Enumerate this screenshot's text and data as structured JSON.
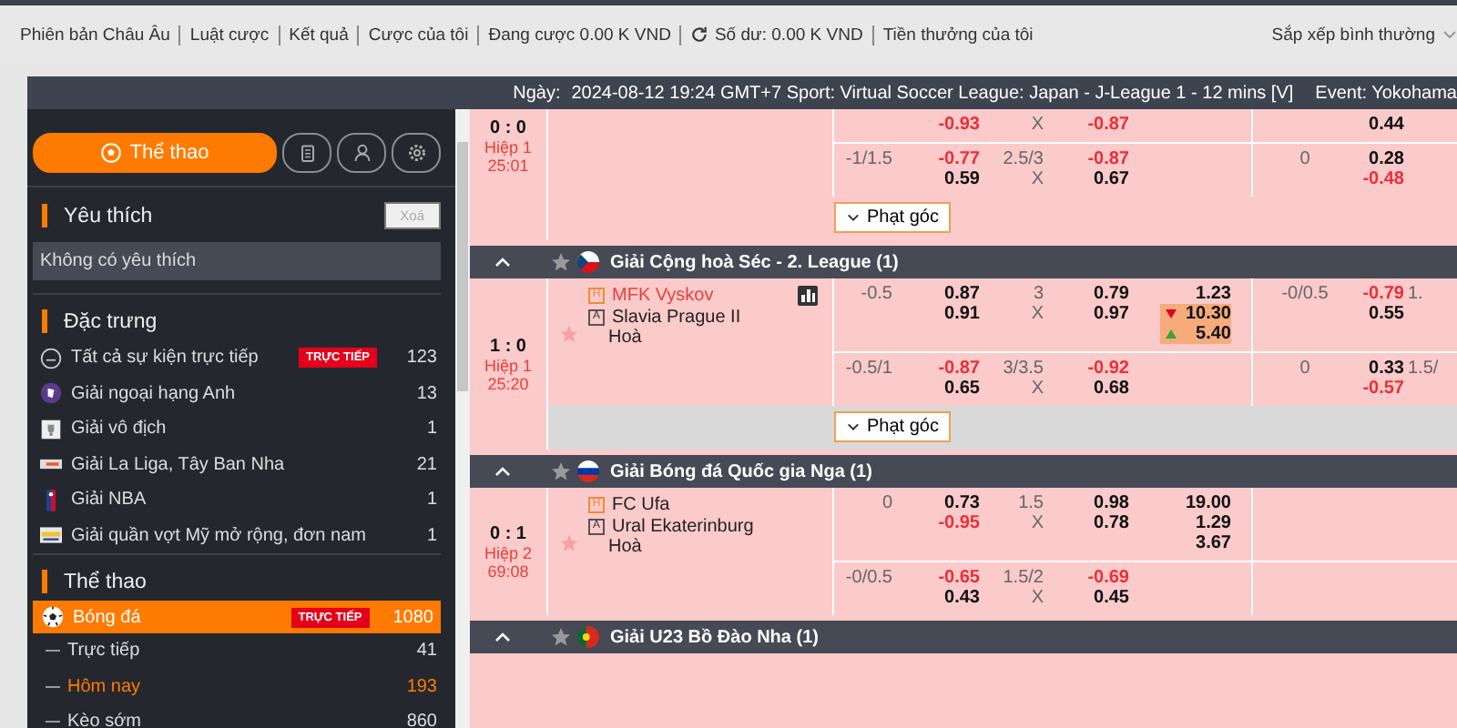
{
  "nav": {
    "items": [
      {
        "label": "Phiên bản Châu Âu",
        "refresh": false
      },
      {
        "label": "Luật cược",
        "refresh": false
      },
      {
        "label": "Kết quả",
        "refresh": false
      },
      {
        "label": "Cược của tôi",
        "refresh": false
      },
      {
        "label": "Đang cược 0.00 K VND",
        "refresh": false
      },
      {
        "label": "Số dư: 0.00 K VND",
        "refresh": true
      },
      {
        "label": "Tiền thưởng của tôi",
        "refresh": false
      }
    ],
    "sort": "Sắp xếp bình thường"
  },
  "info_bar": {
    "date_label": "Ngày:",
    "details": "2024-08-12 19:24 GMT+7 Sport: Virtual Soccer League: Japan - J-League 1 - 12 mins [V]",
    "event": "Event: Yokohama"
  },
  "sidebar": {
    "tabs": [
      {
        "kind": "sports",
        "label": "Thể thao",
        "selected": true
      },
      {
        "kind": "slip",
        "selected": false
      },
      {
        "kind": "account",
        "selected": false
      },
      {
        "kind": "settings",
        "selected": false
      }
    ],
    "favorites": {
      "title": "Yêu thích",
      "clear": "Xoá",
      "empty": "Không có yêu thích"
    },
    "featured": {
      "title": "Đặc trưng",
      "items": [
        {
          "kind": "all",
          "label": "Tất cả sự kiện trực tiếp",
          "badge": "TRỰC TIẾP",
          "count": "123"
        },
        {
          "kind": "league",
          "label": "Giải ngoại hạng Anh",
          "count": "13"
        },
        {
          "kind": "trophy",
          "label": "Giải vô địch",
          "count": "1"
        },
        {
          "kind": "banner",
          "label": "Giải La Liga, Tây Ban Nha",
          "count": "21"
        },
        {
          "kind": "basketball",
          "label": "Giải NBA",
          "count": "1"
        },
        {
          "kind": "tennis",
          "label": "Giải quần vợt Mỹ mở rộng, đơn nam",
          "count": "1"
        }
      ]
    },
    "sports": {
      "title": "Thể thao",
      "items": [
        {
          "label": "Bóng đá",
          "badge": "TRỰC TIẾP",
          "count": "1080",
          "selected": true,
          "children": [
            {
              "label": "Trực tiếp",
              "count": "41",
              "selected": false
            },
            {
              "label": "Hôm nay",
              "count": "193",
              "selected": true
            },
            {
              "label": "Kèo sớm",
              "count": "860",
              "selected": false
            }
          ]
        }
      ]
    }
  },
  "sections": [
    {
      "matches": [
        {
          "score": "0 : 0",
          "period": "Hiệp 1",
          "clock": "25:01",
          "lines": [
            {
              "handicap_odds": [
                {
                  "text": "-0.93",
                  "kind": "neg"
                }
              ],
              "total": [
                {
                  "text": "X",
                  "kind": "line"
                }
              ],
              "total_odds": [
                {
                  "text": "-0.87",
                  "kind": "neg"
                }
              ],
              "half_odds": [
                {
                  "text": "0.44",
                  "kind": "odd"
                }
              ]
            },
            {
              "handicap": [
                {
                  "text": "-1/1.5",
                  "kind": "line"
                }
              ],
              "handicap_odds": [
                {
                  "text": "-0.77",
                  "kind": "neg"
                },
                {
                  "text": "0.59",
                  "kind": "odd"
                }
              ],
              "total": [
                {
                  "text": "2.5/3",
                  "kind": "line"
                },
                {
                  "text": "X",
                  "kind": "line"
                }
              ],
              "total_odds": [
                {
                  "text": "-0.87",
                  "kind": "neg"
                },
                {
                  "text": "0.67",
                  "kind": "odd"
                }
              ],
              "half_handicap": [
                {
                  "text": "0",
                  "kind": "line"
                }
              ],
              "half_odds": [
                {
                  "text": "0.28",
                  "kind": "odd"
                },
                {
                  "text": "-0.48",
                  "kind": "neg"
                }
              ]
            }
          ],
          "corner": {
            "label": "Phạt góc",
            "shaded": false
          }
        }
      ]
    },
    {
      "league": "Giải Cộng hoà Séc - 2. League (1)",
      "flag": {
        "kind": "cz"
      },
      "matches": [
        {
          "score": "1 : 0",
          "period": "Hiệp 1",
          "clock": "25:20",
          "stats": true,
          "teams": [
            {
              "badge": "H",
              "name": "MFK Vyskov",
              "highlight": true
            },
            {
              "badge": "A",
              "name": "Slavia Prague II",
              "highlight": false
            }
          ],
          "draw": "Hoà",
          "lines": [
            {
              "handicap": [
                {
                  "text": "-0.5",
                  "kind": "line"
                }
              ],
              "handicap_odds": [
                {
                  "text": "0.87",
                  "kind": "odd"
                },
                {
                  "text": "0.91",
                  "kind": "odd"
                }
              ],
              "total": [
                {
                  "text": "3",
                  "kind": "line"
                },
                {
                  "text": "X",
                  "kind": "line"
                }
              ],
              "total_odds": [
                {
                  "text": "0.79",
                  "kind": "odd"
                },
                {
                  "text": "0.97",
                  "kind": "odd"
                }
              ],
              "result": [
                {
                  "text": "1.23",
                  "kind": "odd"
                },
                {
                  "text": "10.30",
                  "kind": "falling"
                },
                {
                  "text": "5.40",
                  "kind": "rising"
                }
              ],
              "half_handicap": [
                {
                  "text": "-0/0.5",
                  "kind": "line"
                }
              ],
              "half_odds": [
                {
                  "text": "-0.79",
                  "kind": "neg"
                },
                {
                  "text": "0.55",
                  "kind": "odd"
                }
              ],
              "half_total": [
                {
                  "text": "1.",
                  "kind": "line"
                }
              ]
            },
            {
              "handicap": [
                {
                  "text": "-0.5/1",
                  "kind": "line"
                }
              ],
              "handicap_odds": [
                {
                  "text": "-0.87",
                  "kind": "neg"
                },
                {
                  "text": "0.65",
                  "kind": "odd"
                }
              ],
              "total": [
                {
                  "text": "3/3.5",
                  "kind": "line"
                },
                {
                  "text": "X",
                  "kind": "line"
                }
              ],
              "total_odds": [
                {
                  "text": "-0.92",
                  "kind": "neg"
                },
                {
                  "text": "0.68",
                  "kind": "odd"
                }
              ],
              "half_handicap": [
                {
                  "text": "0",
                  "kind": "line"
                }
              ],
              "half_odds": [
                {
                  "text": "0.33",
                  "kind": "odd"
                },
                {
                  "text": "-0.57",
                  "kind": "neg"
                }
              ],
              "half_total": [
                {
                  "text": "1.5/",
                  "kind": "line"
                }
              ]
            }
          ],
          "corner": {
            "label": "Phạt góc",
            "shaded": true
          }
        }
      ]
    },
    {
      "league": "Giải Bóng đá Quốc gia Nga (1)",
      "flag": {
        "kind": "ru"
      },
      "matches": [
        {
          "score": "0 : 1",
          "period": "Hiệp 2",
          "clock": "69:08",
          "teams": [
            {
              "badge": "H",
              "name": "FC Ufa",
              "highlight": false
            },
            {
              "badge": "A",
              "name": "Ural Ekaterinburg",
              "highlight": false
            }
          ],
          "draw": "Hoà",
          "lines": [
            {
              "handicap": [
                {
                  "text": "0",
                  "kind": "line"
                }
              ],
              "handicap_odds": [
                {
                  "text": "0.73",
                  "kind": "odd"
                },
                {
                  "text": "-0.95",
                  "kind": "neg"
                }
              ],
              "total": [
                {
                  "text": "1.5",
                  "kind": "line"
                },
                {
                  "text": "X",
                  "kind": "line"
                }
              ],
              "total_odds": [
                {
                  "text": "0.98",
                  "kind": "odd"
                },
                {
                  "text": "0.78",
                  "kind": "odd"
                }
              ],
              "result": [
                {
                  "text": "19.00",
                  "kind": "odd"
                },
                {
                  "text": "1.29",
                  "kind": "odd"
                },
                {
                  "text": "3.67",
                  "kind": "odd"
                }
              ]
            },
            {
              "handicap": [
                {
                  "text": "-0/0.5",
                  "kind": "line"
                }
              ],
              "handicap_odds": [
                {
                  "text": "-0.65",
                  "kind": "neg"
                },
                {
                  "text": "0.43",
                  "kind": "odd"
                }
              ],
              "total": [
                {
                  "text": "1.5/2",
                  "kind": "line"
                },
                {
                  "text": "X",
                  "kind": "line"
                }
              ],
              "total_odds": [
                {
                  "text": "-0.69",
                  "kind": "neg"
                },
                {
                  "text": "0.45",
                  "kind": "odd"
                }
              ]
            }
          ]
        }
      ]
    },
    {
      "league": "Giải U23 Bồ Đào Nha (1)",
      "flag": {
        "kind": "pt"
      }
    }
  ]
}
